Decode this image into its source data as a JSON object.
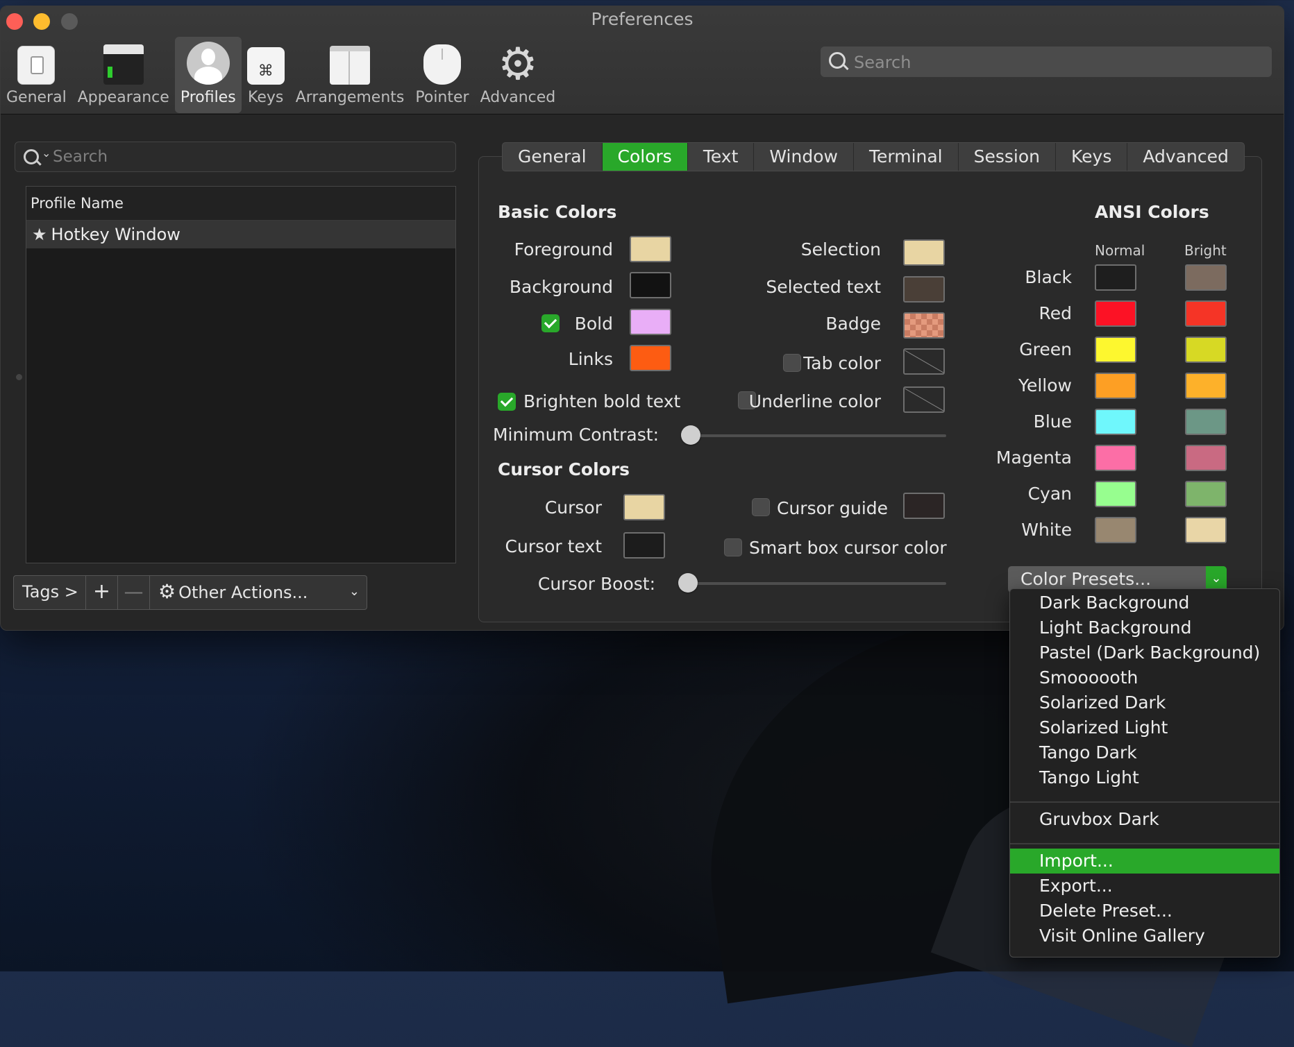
{
  "window": {
    "title": "Preferences"
  },
  "toolbar": {
    "items": [
      {
        "label": "General",
        "icon": "general-icon"
      },
      {
        "label": "Appearance",
        "icon": "appearance-icon"
      },
      {
        "label": "Profiles",
        "icon": "profiles-icon",
        "active": true
      },
      {
        "label": "Keys",
        "icon": "keys-icon"
      },
      {
        "label": "Arrangements",
        "icon": "arrangements-icon"
      },
      {
        "label": "Pointer",
        "icon": "pointer-icon"
      },
      {
        "label": "Advanced",
        "icon": "gear-icon"
      }
    ],
    "keys_glyph": "⌘",
    "advanced_glyph": "⚙",
    "search_placeholder": "Search"
  },
  "profiles": {
    "search_placeholder": "Search",
    "column_header": "Profile Name",
    "rows": [
      {
        "star": "★",
        "name": "Hotkey Window"
      }
    ],
    "bottom": {
      "tags": "Tags >",
      "plus": "+",
      "minus": "—",
      "gear": "⚙",
      "other_actions": "Other Actions...",
      "chevron": "⌄"
    }
  },
  "tabs": [
    "General",
    "Colors",
    "Text",
    "Window",
    "Terminal",
    "Session",
    "Keys",
    "Advanced"
  ],
  "active_tab": "Colors",
  "basic": {
    "title": "Basic Colors",
    "foreground": {
      "label": "Foreground",
      "color": "#e8d5a3"
    },
    "background": {
      "label": "Background",
      "color": "#121212"
    },
    "bold": {
      "label": "Bold",
      "checked": true,
      "color": "#e9aef7"
    },
    "links": {
      "label": "Links",
      "color": "#fd5c12"
    },
    "selection": {
      "label": "Selection",
      "color": "#e8d5a3"
    },
    "selected_text": {
      "label": "Selected text",
      "color": "#4a3f37"
    },
    "badge": {
      "label": "Badge"
    },
    "tab_color": {
      "label": "Tab color",
      "checked": false
    },
    "underline_color": {
      "label": "Underline color",
      "checked": false
    },
    "brighten_bold": {
      "label": "Brighten bold text",
      "checked": true
    },
    "min_contrast": {
      "label": "Minimum Contrast:",
      "value": 0
    }
  },
  "cursor": {
    "title": "Cursor Colors",
    "cursor": {
      "label": "Cursor",
      "color": "#e8d5a3"
    },
    "cursor_text": {
      "label": "Cursor text",
      "color": "#1c1c1c"
    },
    "cursor_guide": {
      "label": "Cursor guide",
      "checked": false,
      "color": "#2b2525"
    },
    "smart_box": {
      "label": "Smart box cursor color",
      "checked": false
    },
    "boost": {
      "label": "Cursor Boost:",
      "value": 0
    }
  },
  "ansi": {
    "title": "ANSI Colors",
    "normal_label": "Normal",
    "bright_label": "Bright",
    "rows": [
      {
        "name": "Black",
        "normal": "#1e1e1e",
        "bright": "#7c6b5f"
      },
      {
        "name": "Red",
        "normal": "#fc1225",
        "bright": "#f53426"
      },
      {
        "name": "Green",
        "normal": "#fdf72f",
        "bright": "#d7d924"
      },
      {
        "name": "Yellow",
        "normal": "#fd9f24",
        "bright": "#fdb12a"
      },
      {
        "name": "Blue",
        "normal": "#6ff7fc",
        "bright": "#6c9786"
      },
      {
        "name": "Magenta",
        "normal": "#fc6ea6",
        "bright": "#c96a82"
      },
      {
        "name": "Cyan",
        "normal": "#97fe8f",
        "bright": "#7eb46b"
      },
      {
        "name": "White",
        "normal": "#988770",
        "bright": "#e9d6a7"
      }
    ]
  },
  "presets": {
    "button_label": "Color Presets...",
    "chevron": "⌄",
    "menu": [
      "Dark Background",
      "Light Background",
      "Pastel (Dark Background)",
      "Smoooooth",
      "Solarized Dark",
      "Solarized Light",
      "Tango Dark",
      "Tango Light",
      "Gruvbox Dark",
      "Import...",
      "Export...",
      "Delete Preset...",
      "Visit Online Gallery"
    ],
    "highlighted": "Import..."
  },
  "accent": "#29a82a"
}
